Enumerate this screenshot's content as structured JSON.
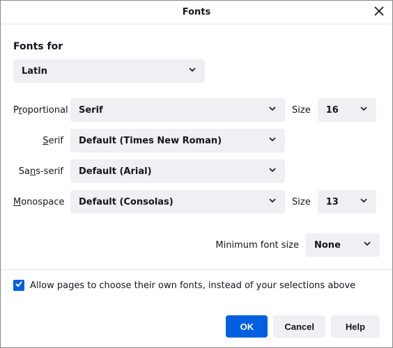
{
  "title": "Fonts",
  "section_heading": "Fonts for",
  "language": "Latin",
  "size_label": "Size",
  "min_font_label": "Minimum font size",
  "fields": {
    "proportional": {
      "label_pre": "P",
      "label_u": "r",
      "label_post": "oportional",
      "value": "Serif",
      "size": "16"
    },
    "serif": {
      "label_pre": "",
      "label_u": "S",
      "label_post": "erif",
      "value": "Default (Times New Roman)"
    },
    "sans": {
      "label_pre": "Sa",
      "label_u": "n",
      "label_post": "s-serif",
      "value": "Default (Arial)"
    },
    "mono": {
      "label_pre": "",
      "label_u": "M",
      "label_post": "onospace",
      "value": "Default (Consolas)",
      "size": "13"
    }
  },
  "min_size_value": "None",
  "checkbox": {
    "checked": true,
    "pre": "",
    "u": "A",
    "post": "llow pages to choose their own fonts, instead of your selections above"
  },
  "buttons": {
    "ok": "OK",
    "cancel": "Cancel",
    "help_u": "H",
    "help_post": "elp"
  }
}
